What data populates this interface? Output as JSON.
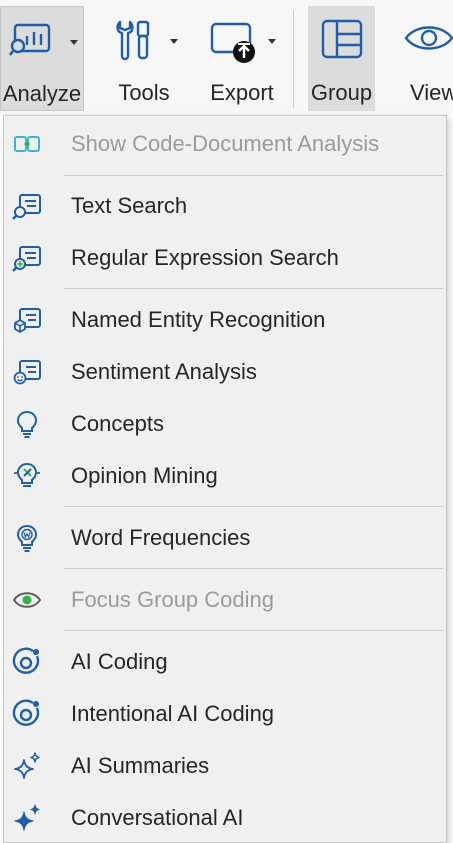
{
  "ribbon": {
    "analyze_label": "Analyze",
    "tools_label": "Tools",
    "export_label": "Export",
    "group_label": "Group",
    "view_label": "View"
  },
  "menu": {
    "items": [
      {
        "label": "Show Code-Document Analysis",
        "icon": "code-document-analysis-icon",
        "enabled": false
      },
      {
        "label": "Text Search",
        "icon": "text-search-icon",
        "enabled": true
      },
      {
        "label": "Regular Expression Search",
        "icon": "regex-search-icon",
        "enabled": true
      },
      {
        "label": "Named Entity Recognition",
        "icon": "named-entity-icon",
        "enabled": true
      },
      {
        "label": "Sentiment Analysis",
        "icon": "sentiment-icon",
        "enabled": true
      },
      {
        "label": "Concepts",
        "icon": "lightbulb-icon",
        "enabled": true
      },
      {
        "label": "Opinion Mining",
        "icon": "opinion-mining-icon",
        "enabled": true
      },
      {
        "label": "Word Frequencies",
        "icon": "word-frequencies-icon",
        "enabled": true
      },
      {
        "label": "Focus Group Coding",
        "icon": "eye-icon",
        "enabled": false
      },
      {
        "label": "AI Coding",
        "icon": "ai-coding-icon",
        "enabled": true
      },
      {
        "label": "Intentional AI Coding",
        "icon": "intentional-ai-coding-icon",
        "enabled": true
      },
      {
        "label": "AI Summaries",
        "icon": "sparkle-icon",
        "enabled": true
      },
      {
        "label": "Conversational AI",
        "icon": "sparkle-icon",
        "enabled": true
      }
    ]
  },
  "colors": {
    "icon_blue": "#1f5fa8",
    "icon_green": "#3cae4a",
    "disabled_text": "#9b9b9b",
    "menu_bg": "#f0f0f0"
  }
}
